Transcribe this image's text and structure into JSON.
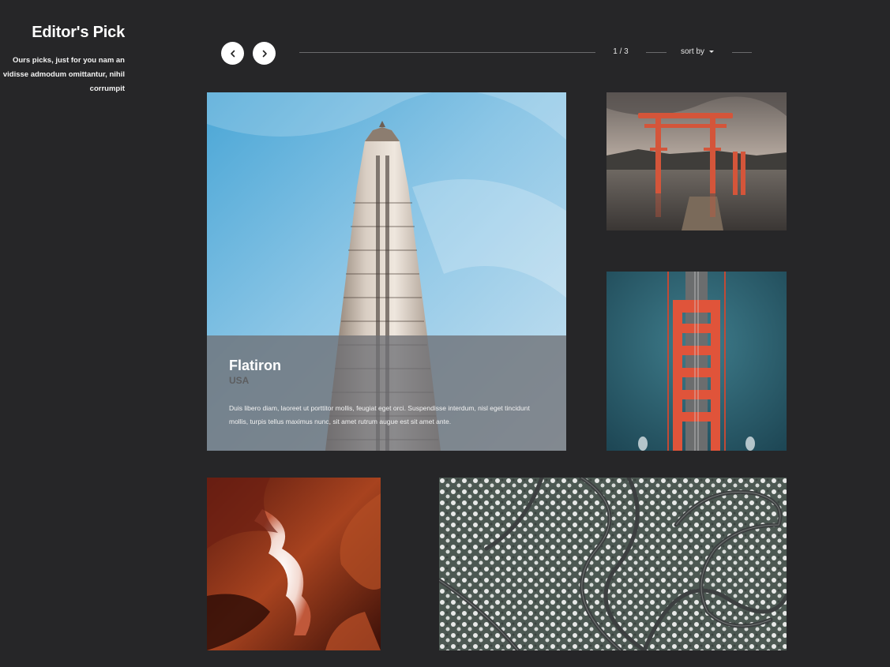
{
  "sidebar": {
    "title": "Editor's Pick",
    "description": "Ours picks, just for you nam an vidisse admodum omittantur, nihil corrumpit"
  },
  "toolbar": {
    "prev_icon": "chevron-left-icon",
    "next_icon": "chevron-right-icon",
    "pager": "1 / 3",
    "sort_label": "sort by"
  },
  "featured": {
    "title": "Flatiron",
    "subtitle": "USA",
    "description": "Duis libero diam, laoreet ut porttitor mollis, feugiat eget orci. Suspendisse interdum, nisl eget tincidunt mollis, turpis tellus maximus nunc, sit amet rutrum augue est sit amet ante."
  },
  "colors": {
    "background": "#262628",
    "overlay": "#6e7074",
    "accent_text": "#ffffff"
  }
}
